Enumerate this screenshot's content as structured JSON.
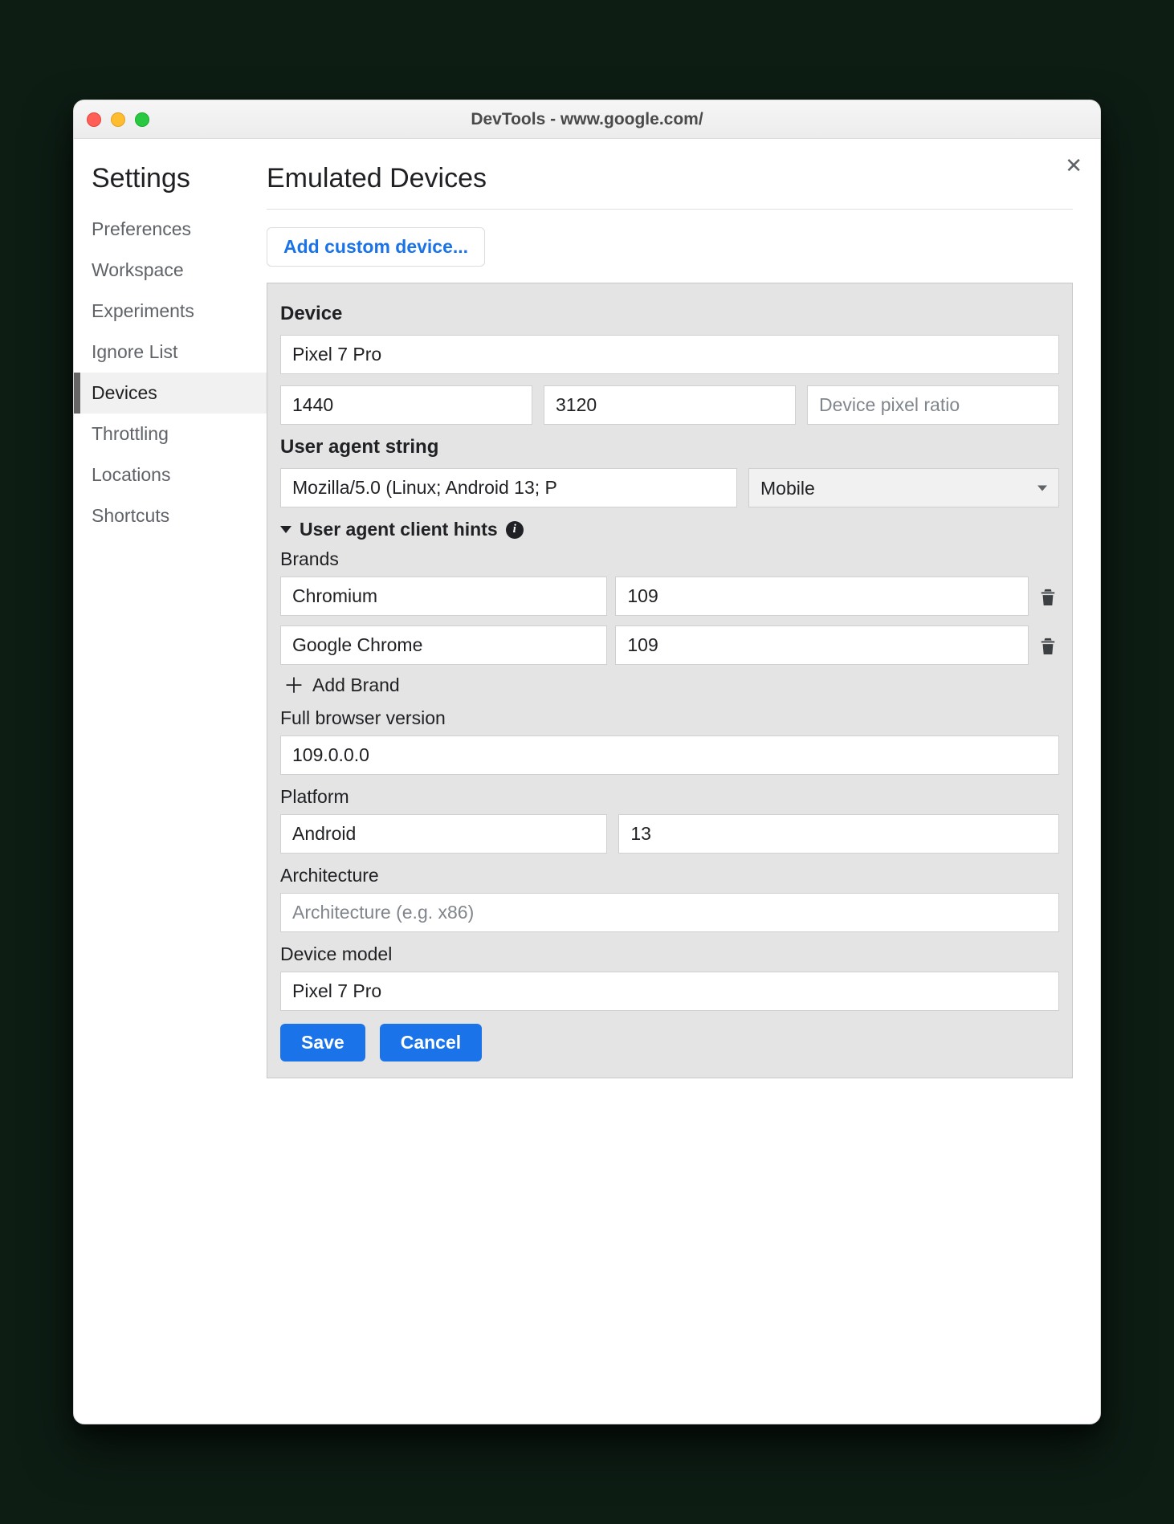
{
  "window": {
    "title": "DevTools - www.google.com/"
  },
  "sidebar": {
    "heading": "Settings",
    "items": [
      {
        "label": "Preferences"
      },
      {
        "label": "Workspace"
      },
      {
        "label": "Experiments"
      },
      {
        "label": "Ignore List"
      },
      {
        "label": "Devices",
        "selected": true
      },
      {
        "label": "Throttling"
      },
      {
        "label": "Locations"
      },
      {
        "label": "Shortcuts"
      }
    ]
  },
  "main": {
    "heading": "Emulated Devices",
    "add_custom_label": "Add custom device..."
  },
  "form": {
    "device_heading": "Device",
    "device_name": "Pixel 7 Pro",
    "width": "1440",
    "height": "3120",
    "dpr_placeholder": "Device pixel ratio",
    "ua_heading": "User agent string",
    "ua_value": "Mozilla/5.0 (Linux; Android 13; P",
    "ua_type": "Mobile",
    "hints": {
      "heading": "User agent client hints",
      "brands_label": "Brands",
      "brands": [
        {
          "name": "Chromium",
          "version": "109"
        },
        {
          "name": "Google Chrome",
          "version": "109"
        }
      ],
      "add_brand_label": "Add Brand",
      "full_version_label": "Full browser version",
      "full_version": "109.0.0.0",
      "platform_label": "Platform",
      "platform": "Android",
      "platform_version": "13",
      "architecture_label": "Architecture",
      "architecture_placeholder": "Architecture (e.g. x86)",
      "device_model_label": "Device model",
      "device_model": "Pixel 7 Pro"
    },
    "save_label": "Save",
    "cancel_label": "Cancel"
  }
}
